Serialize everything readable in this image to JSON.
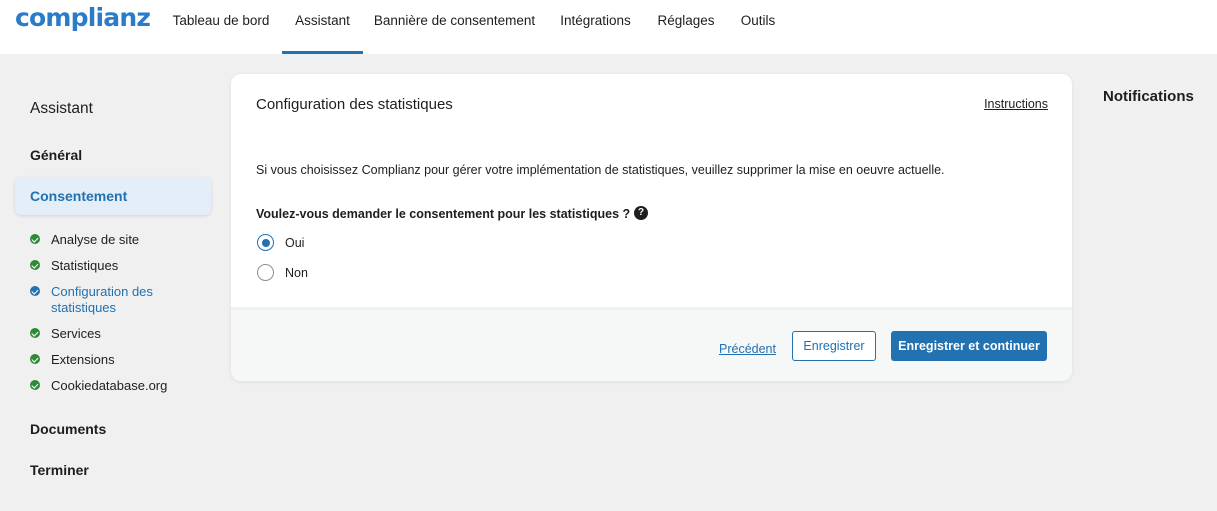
{
  "brand": {
    "logo_text": "complianz",
    "accent_color": "#2271b1",
    "success_color": "#2e8a37"
  },
  "nav": {
    "items": [
      {
        "label": "Tableau de bord"
      },
      {
        "label": "Assistant",
        "active": true
      },
      {
        "label": "Bannière de consentement"
      },
      {
        "label": "Intégrations"
      },
      {
        "label": "Réglages"
      },
      {
        "label": "Outils"
      }
    ]
  },
  "sidebar": {
    "heading": "Assistant",
    "groups": {
      "general": "Général",
      "consent": "Consentement",
      "documents": "Documents",
      "finish": "Terminer"
    },
    "steps": [
      {
        "label": "Analyse de site",
        "status": "done"
      },
      {
        "label": "Statistiques",
        "status": "done"
      },
      {
        "label_line1": "Configuration des",
        "label_line2": "statistiques",
        "status": "current"
      },
      {
        "label": "Services",
        "status": "done"
      },
      {
        "label": "Extensions",
        "status": "done"
      },
      {
        "label": "Cookiedatabase.org",
        "status": "done"
      }
    ]
  },
  "card": {
    "title": "Configuration des statistiques",
    "instructions_link": "Instructions",
    "description": "Si vous choisissez Complianz pour gérer votre implémentation de statistiques, veuillez supprimer la mise en oeuvre actuelle.",
    "question": "Voulez-vous demander le consentement pour les statistiques ?",
    "help_icon_glyph": "?",
    "options": [
      {
        "label": "Oui",
        "selected": true
      },
      {
        "label": "Non",
        "selected": false
      }
    ],
    "footer": {
      "previous_link": "Précédent",
      "save_button": "Enregistrer",
      "save_continue_button": "Enregistrer et continuer"
    }
  },
  "notifications": {
    "heading": "Notifications"
  }
}
